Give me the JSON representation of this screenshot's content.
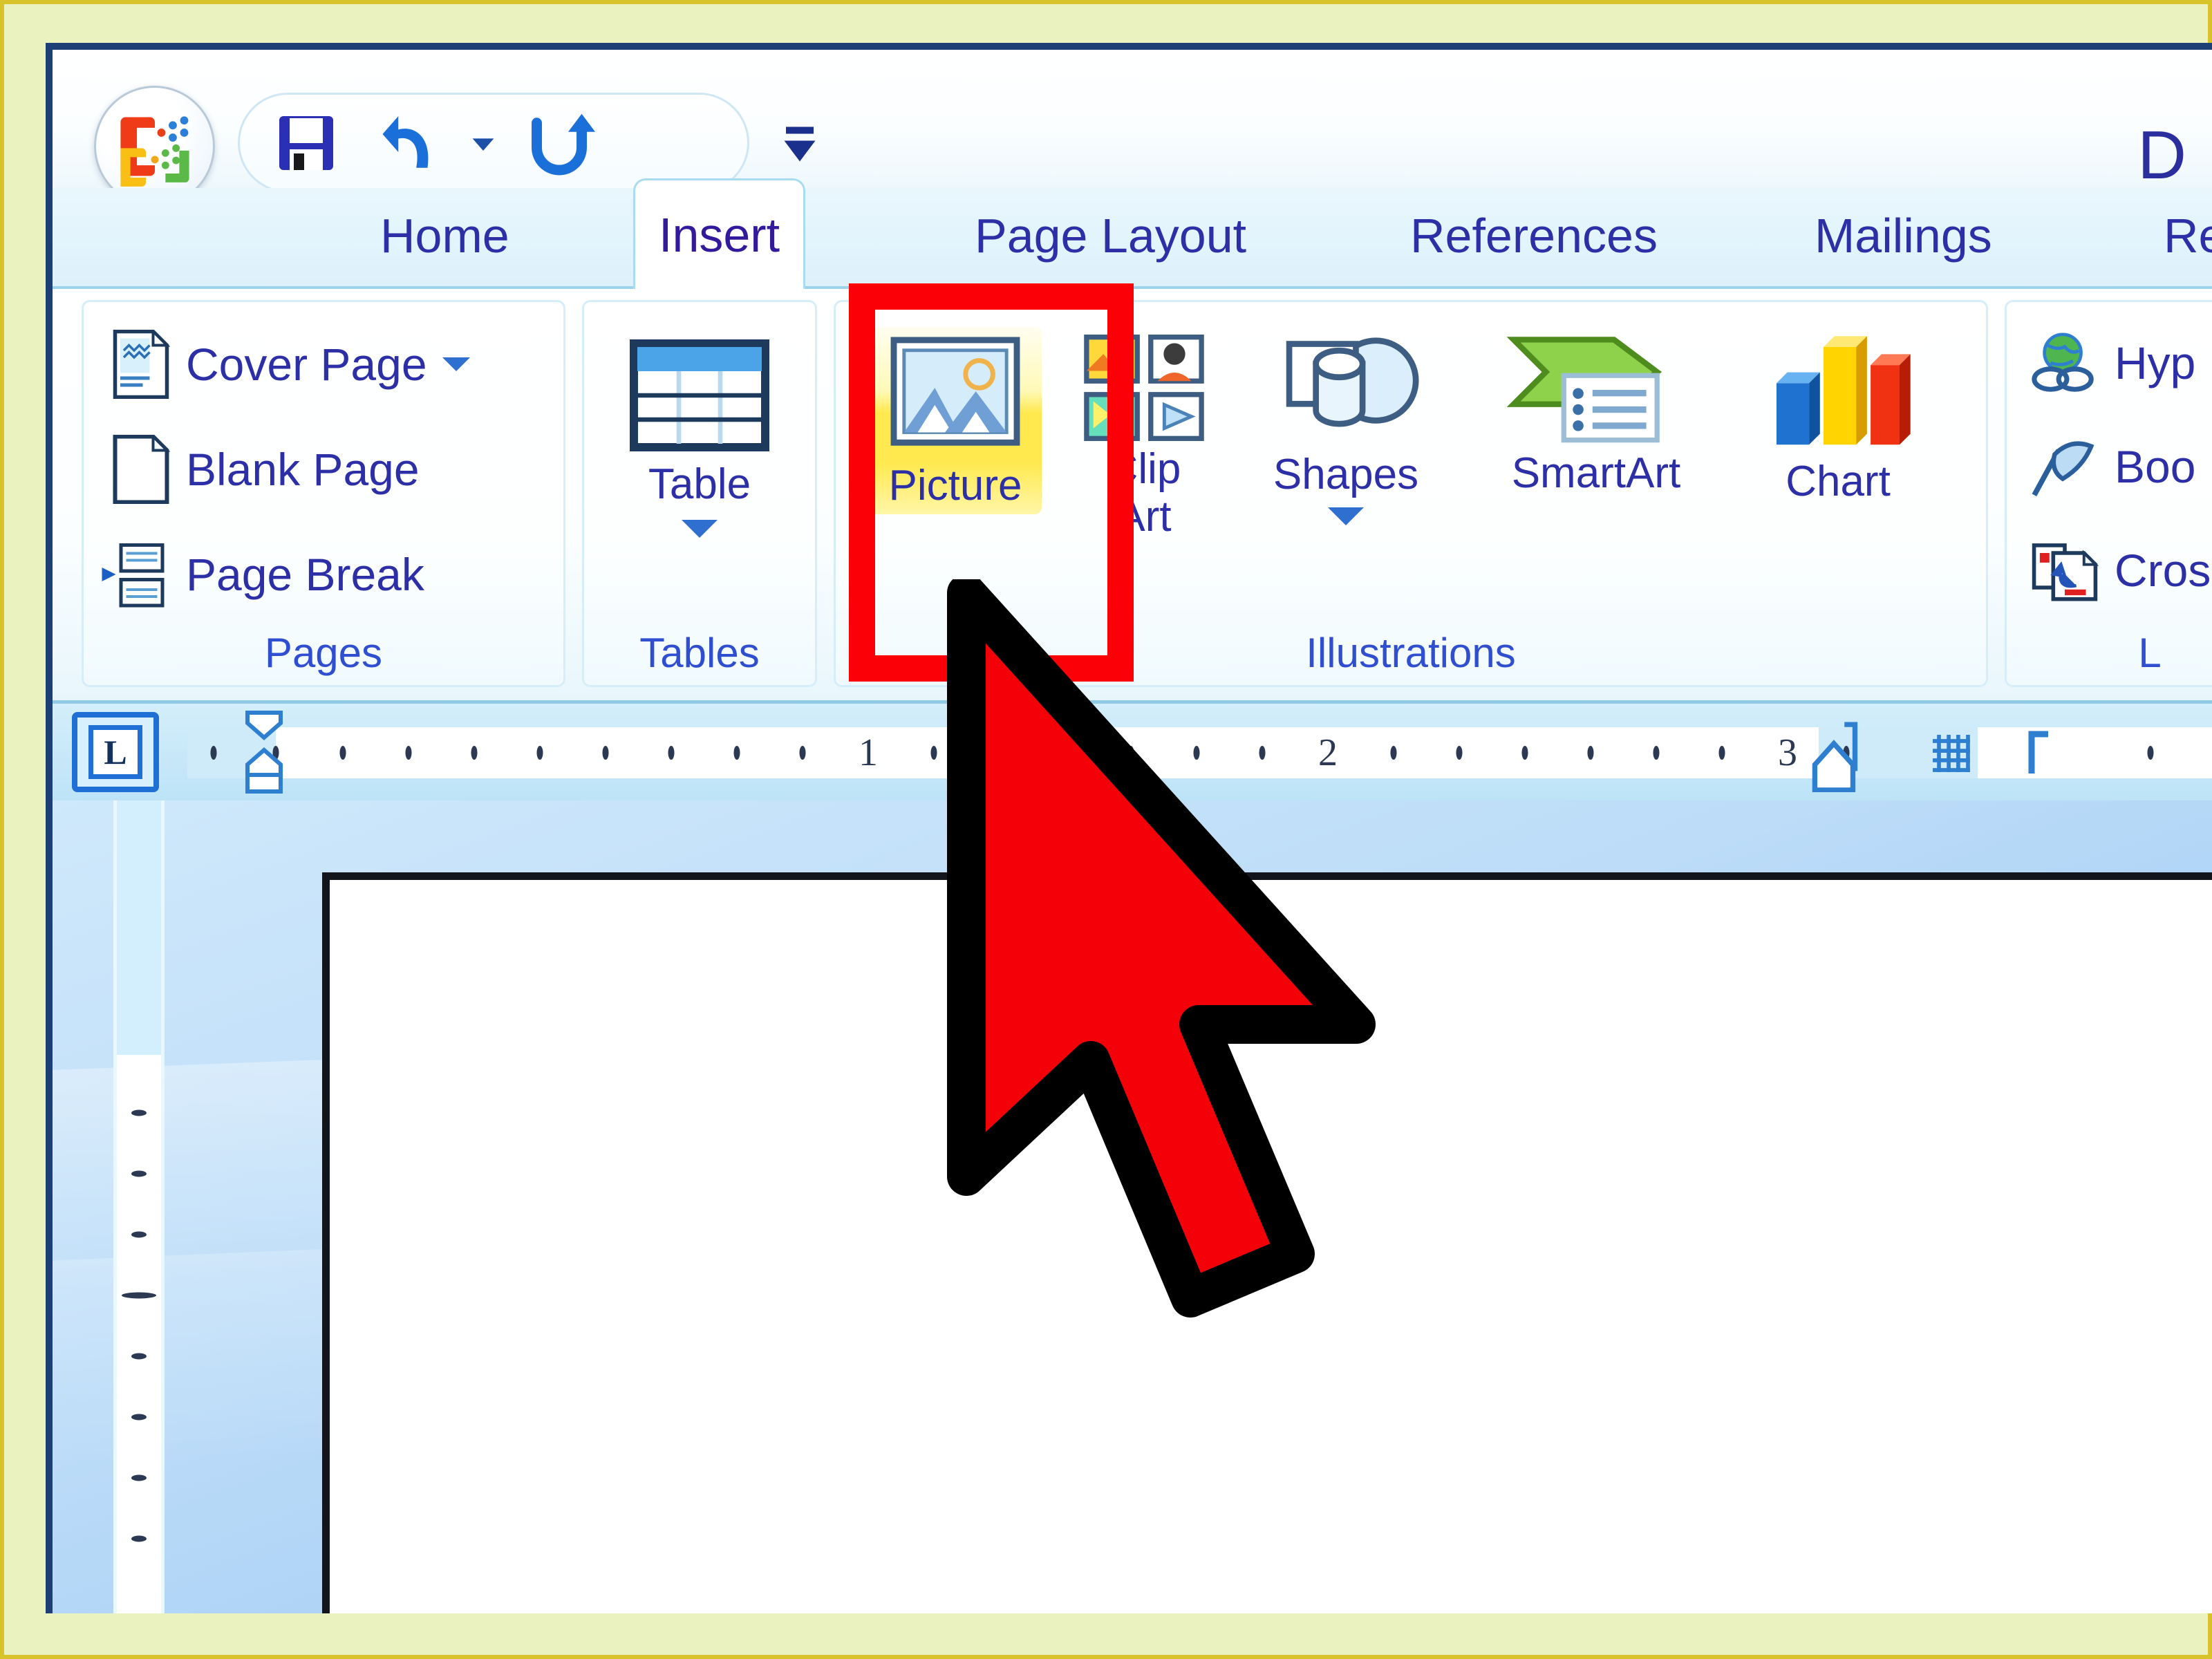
{
  "window": {
    "title": "D"
  },
  "quick_access": {
    "save_label": "Save",
    "undo_label": "Undo",
    "undo_dropdown_label": "Undo dropdown",
    "redo_label": "Redo",
    "customize_label": "Customize Quick Access Toolbar",
    "office_button_label": "Office Button"
  },
  "tabs": [
    {
      "label": "Home",
      "active": false
    },
    {
      "label": "Insert",
      "active": true
    },
    {
      "label": "Page Layout",
      "active": false
    },
    {
      "label": "References",
      "active": false
    },
    {
      "label": "Mailings",
      "active": false
    },
    {
      "label": "Re",
      "active": false
    }
  ],
  "ribbon": {
    "groups": [
      {
        "name": "Pages",
        "label": "Pages",
        "items": [
          {
            "label": "Cover Page",
            "icon": "cover-page-icon",
            "has_dropdown": true
          },
          {
            "label": "Blank Page",
            "icon": "blank-page-icon",
            "has_dropdown": false
          },
          {
            "label": "Page Break",
            "icon": "page-break-icon",
            "has_dropdown": false
          }
        ]
      },
      {
        "name": "Tables",
        "label": "Tables",
        "items": [
          {
            "label": "Table",
            "icon": "table-icon",
            "has_dropdown": true
          }
        ]
      },
      {
        "name": "Illustrations",
        "label": "Illustrations",
        "items": [
          {
            "label": "Picture",
            "icon": "picture-icon",
            "has_dropdown": false,
            "highlighted": true
          },
          {
            "label": "Clip\nArt",
            "icon": "clip-art-icon",
            "has_dropdown": false
          },
          {
            "label": "Shapes",
            "icon": "shapes-icon",
            "has_dropdown": true
          },
          {
            "label": "SmartArt",
            "icon": "smartart-icon",
            "has_dropdown": false
          },
          {
            "label": "Chart",
            "icon": "chart-icon",
            "has_dropdown": false
          }
        ]
      },
      {
        "name": "Links",
        "label": "L",
        "items": [
          {
            "label": "Hyp",
            "icon": "hyperlink-icon",
            "has_dropdown": false
          },
          {
            "label": "Boo",
            "icon": "bookmark-icon",
            "has_dropdown": false
          },
          {
            "label": "Cros",
            "icon": "cross-reference-icon",
            "has_dropdown": false
          }
        ]
      }
    ]
  },
  "ruler": {
    "tab_selector_glyph": "L",
    "horizontal_numbers": [
      "1",
      "2",
      "3"
    ],
    "unit": "inches"
  },
  "annotation": {
    "highlight_color": "#fb0007",
    "cursor_fill": "#f40009",
    "cursor_outline": "#000000",
    "highlight_target": "Picture",
    "cursor_label": "pointer-arrow"
  },
  "theme": {
    "outer_background": "#eaf3bf",
    "outer_border": "#d8c32a",
    "window_border": "#1c3f75",
    "ribbon_text": "#2c2fa6",
    "group_label": "#2f4fd0",
    "ruler_background": "#bde3f7",
    "picture_highlight": "#ffe94e"
  }
}
